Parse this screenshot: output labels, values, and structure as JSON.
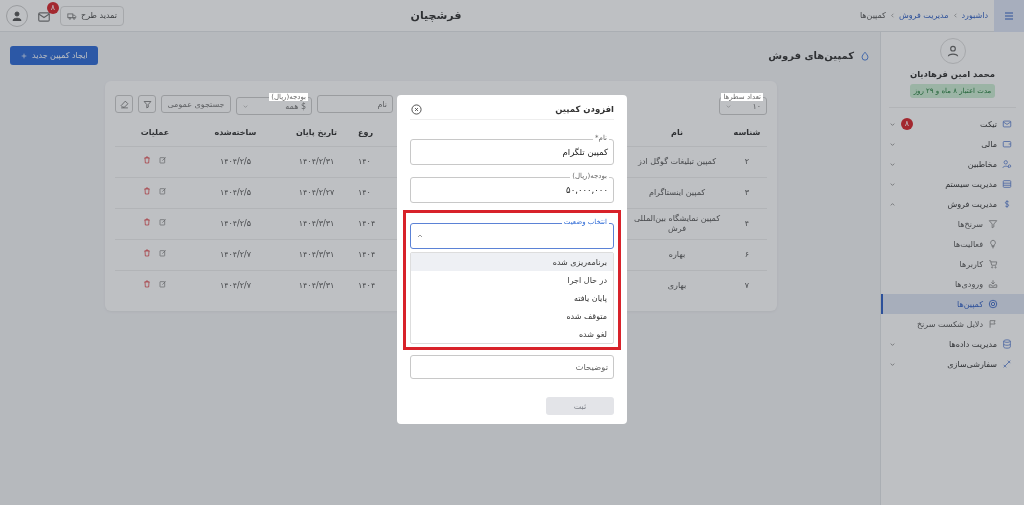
{
  "header": {
    "breadcrumbs": [
      "داشبورد",
      "مدیریت فروش",
      "کمپین‌ها"
    ],
    "brand": "فرشچیان",
    "renew_button": "تمدید طرح",
    "notification_count": "۸"
  },
  "sidebar": {
    "user_name": "محمد امین فرهادیان",
    "validity": "مدت اعتبار ۸ ماه و ۲۹ روز",
    "items": [
      {
        "label": "تیکت",
        "badge": "۸",
        "expanded": false,
        "selected": false
      },
      {
        "label": "مالی",
        "expanded": false,
        "selected": false
      },
      {
        "label": "مخاطبین",
        "expanded": false,
        "selected": false
      },
      {
        "label": "مدیریت سیستم",
        "expanded": false,
        "selected": false
      },
      {
        "label": "مدیریت فروش",
        "expanded": true,
        "selected": false,
        "children": [
          {
            "label": "سرنخ‌ها",
            "selected": false
          },
          {
            "label": "فعالیت‌ها",
            "selected": false
          },
          {
            "label": "کاربرها",
            "selected": false
          },
          {
            "label": "ورودی‌ها",
            "selected": false
          },
          {
            "label": "کمپین‌ها",
            "selected": true
          },
          {
            "label": "دلایل شکست سرنخ",
            "selected": false
          }
        ]
      },
      {
        "label": "مدیریت داده‌ها",
        "expanded": false,
        "selected": false
      },
      {
        "label": "سفارشی‌سازی",
        "expanded": false,
        "selected": false
      }
    ]
  },
  "page": {
    "title": "کمپین‌های فروش",
    "create_button": "ایجاد کمپین جدید"
  },
  "filters": {
    "rows_label": "تعداد سطرها",
    "rows_value": "۱۰",
    "name_placeholder": "نام",
    "budget_label": "بودجه(ریال)",
    "budget_value": "$ همه",
    "search_placeholder": "جستجوی عمومی"
  },
  "table": {
    "columns": [
      "شناسه",
      "نام",
      "روع",
      "تاریخ پایان",
      "ساخته‌شده",
      "عملیات"
    ],
    "rows": [
      [
        "۲",
        "کمپین تبلیغات گوگل ادز",
        "۱۴۰",
        "۱۴۰۴/۲/۳۱",
        "۱۴۰۴/۲/۵"
      ],
      [
        "۳",
        "کمپین اینستاگرام",
        "۱۴۰",
        "۱۴۰۴/۲/۲۷",
        "۱۴۰۴/۲/۵"
      ],
      [
        "۴",
        "کمپین نمایشگاه بین‌المللی فرش",
        "۱۴۰۴",
        "۱۴۰۴/۳/۳۱",
        "۱۴۰۴/۲/۵"
      ],
      [
        "۶",
        "بهاره",
        "۱۴۰۴",
        "۱۴۰۴/۳/۳۱",
        "۱۴۰۴/۲/۷"
      ],
      [
        "۷",
        "بهاری",
        "۱۴۰۴",
        "۱۴۰۴/۳/۳۱",
        "۱۴۰۴/۲/۷"
      ]
    ]
  },
  "modal": {
    "title": "افزودن کمپین",
    "name_field": {
      "label": "نام*",
      "value": "کمپین تلگرام"
    },
    "budget_field": {
      "label": "بودجه(ریال)",
      "value": "۵۰,۰۰۰,۰۰۰"
    },
    "status_select": {
      "label": "انتخاب وضعیت",
      "open": true,
      "highlighted": true,
      "options": [
        {
          "label": "برنامه‌ریزی شده",
          "selected": true
        },
        {
          "label": "در حال اجرا",
          "selected": false
        },
        {
          "label": "پایان یافته",
          "selected": false
        },
        {
          "label": "متوقف شده",
          "selected": false
        },
        {
          "label": "لغو شده",
          "selected": false
        }
      ]
    },
    "description_placeholder": "توضیحات",
    "submit_button": {
      "label": "ثبت",
      "disabled": true
    }
  }
}
